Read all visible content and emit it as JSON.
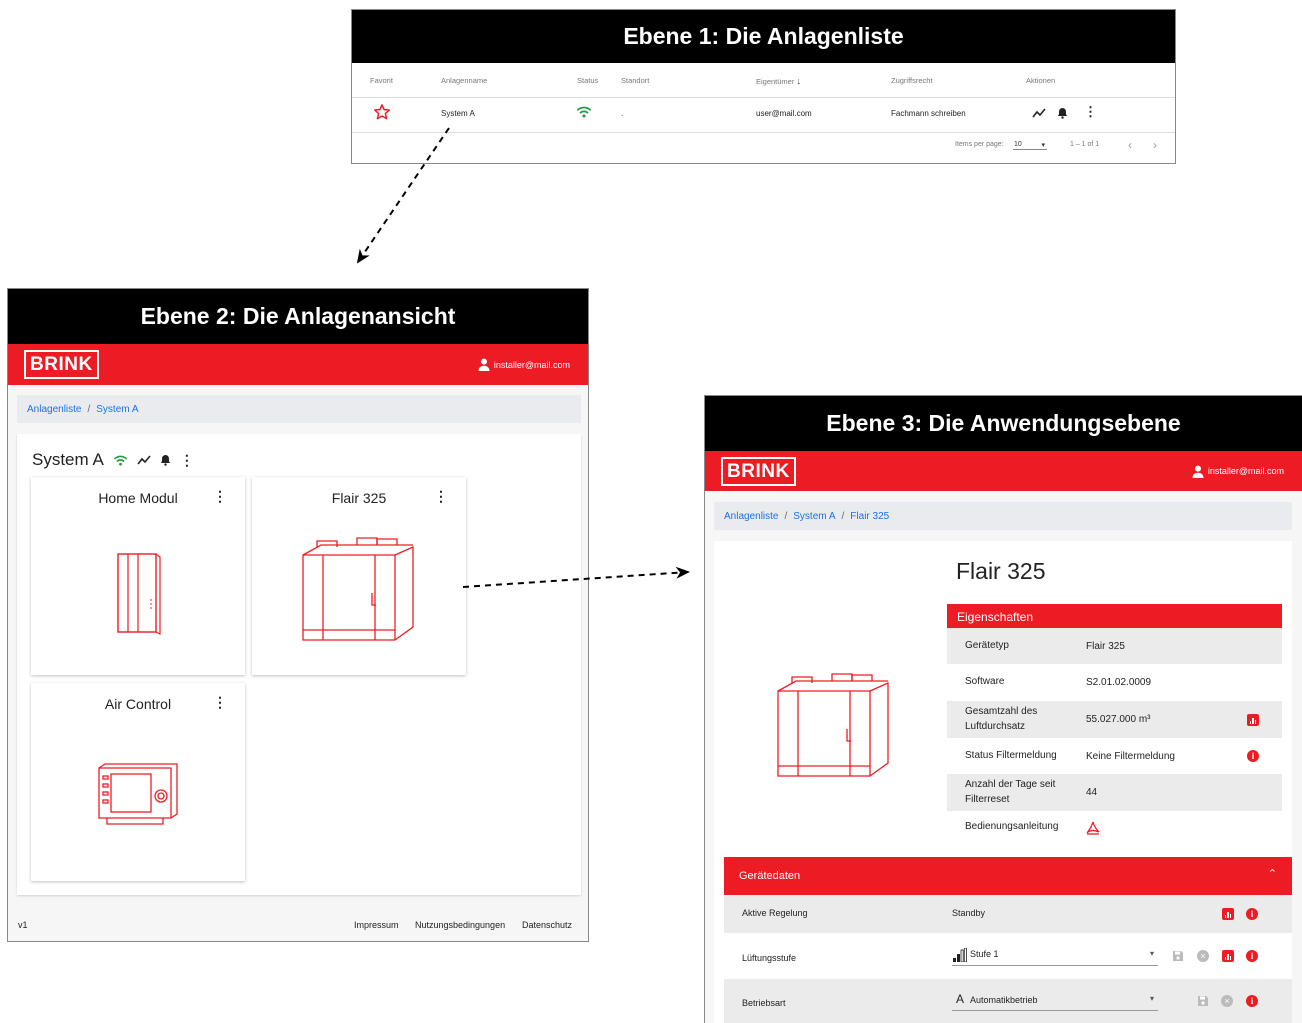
{
  "panel1": {
    "heading": "Ebene 1: Die Anlagenliste",
    "columns": [
      "Favorit",
      "Anlagenname",
      "Status",
      "Standort",
      "Eigentümer",
      "Zugriffsrecht",
      "Aktionen"
    ],
    "row": {
      "name": "System A",
      "location": ".",
      "owner": "user@mail.com",
      "access": "Fachmann schreiben"
    },
    "items_per_page_label": "Items per page:",
    "items_per_page_value": "10",
    "range": "1 – 1 of 1"
  },
  "panel2": {
    "heading": "Ebene 2: Die Anlagenansicht",
    "logo": "BRINK",
    "user_email": "installer@mail.com",
    "breadcrumb": [
      "Anlagenliste",
      "System A"
    ],
    "system_name": "System A",
    "cards": [
      {
        "title": "Home Modul"
      },
      {
        "title": "Flair 325"
      },
      {
        "title": "Air Control"
      }
    ],
    "footer": {
      "version": "v1",
      "links": [
        "Impressum",
        "Nutzungsbedingungen",
        "Datenschutz"
      ]
    }
  },
  "panel3": {
    "heading": "Ebene 3: Die Anwendungsebene",
    "logo": "BRINK",
    "user_email": "installer@mail.com",
    "breadcrumb": [
      "Anlagenliste",
      "System A",
      "Flair 325"
    ],
    "device_title": "Flair 325",
    "properties_header": "Eigenschaften",
    "properties": [
      {
        "label": "Gerätetyp",
        "value": "Flair 325"
      },
      {
        "label": "Software",
        "value": "S2.01.02.0009"
      },
      {
        "label": "Gesamtzahl des Luftdurchsatz",
        "value": "55.027.000 m³"
      },
      {
        "label": "Status Filtermeldung",
        "value": "Keine Filtermeldung"
      },
      {
        "label": "Anzahl der Tage seit Filterreset",
        "value": "44"
      },
      {
        "label": "Bedienungsanleitung",
        "value": ""
      }
    ],
    "device_data_header": "Gerätedaten",
    "device_data": [
      {
        "label": "Aktive Regelung",
        "value": "Standby"
      },
      {
        "label": "Lüftungsstufe",
        "value": "Stufe 1"
      },
      {
        "label": "Betriebsart",
        "value": "Automatikbetrieb"
      }
    ]
  },
  "colors": {
    "brand_red": "#ed1c24",
    "status_green": "#1e9e3a",
    "link_blue": "#1a73e8"
  }
}
